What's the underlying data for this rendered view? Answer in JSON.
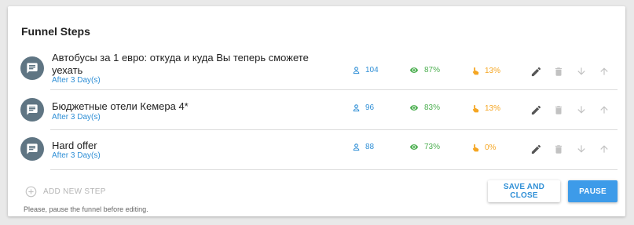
{
  "header": {
    "title": "Funnel Steps"
  },
  "colors": {
    "avatar": "#5f7583",
    "users": "#2f8fd6",
    "views": "#4caf50",
    "clicks": "#f5a623",
    "primary": "#3d9be9"
  },
  "steps": [
    {
      "name": "Автобусы за 1 евро: откуда и куда Вы теперь сможете уехать",
      "delay": "After 3 Day(s)",
      "users": "104",
      "views": "87%",
      "clicks": "13%"
    },
    {
      "name": "Бюджетные отели Кемера 4*",
      "delay": "After 3 Day(s)",
      "users": "96",
      "views": "83%",
      "clicks": "13%"
    },
    {
      "name": "Hard offer",
      "delay": "After 3 Day(s)",
      "users": "88",
      "views": "73%",
      "clicks": "0%"
    }
  ],
  "footer": {
    "add_step_label": "ADD NEW STEP",
    "note": "Please, pause the funnel before editing.",
    "save_label": "SAVE AND CLOSE",
    "pause_label": "PAUSE"
  },
  "icons": {
    "avatar": "message-icon",
    "users": "user-icon",
    "views": "eye-icon",
    "clicks": "pointer-hand-icon",
    "edit": "pencil-icon",
    "delete": "trash-icon",
    "down": "arrow-down-icon",
    "up": "arrow-up-icon",
    "add": "plus-circle-icon"
  }
}
